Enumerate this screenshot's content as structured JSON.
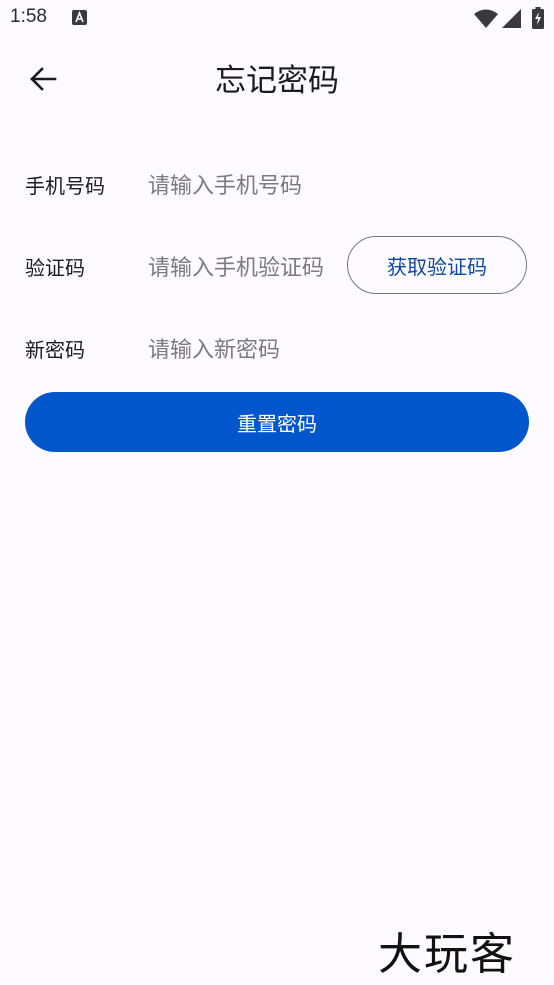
{
  "status_bar": {
    "time": "1:58",
    "icons": [
      "notification-a-icon",
      "wifi-icon",
      "signal-icon",
      "battery-charging-icon"
    ]
  },
  "header": {
    "title": "忘记密码",
    "back_icon": "arrow-left-icon"
  },
  "form": {
    "phone": {
      "label": "手机号码",
      "placeholder": "请输入手机号码",
      "value": ""
    },
    "code": {
      "label": "验证码",
      "placeholder": "请输入手机验证码",
      "value": "",
      "button_label": "获取验证码"
    },
    "new_password": {
      "label": "新密码",
      "placeholder": "请输入新密码",
      "value": ""
    },
    "submit_label": "重置密码"
  },
  "watermark": "大玩客",
  "colors": {
    "background": "#fdfbff",
    "primary": "#0156cc",
    "outline": "#76767c",
    "code_button_text": "#0d47a1"
  }
}
